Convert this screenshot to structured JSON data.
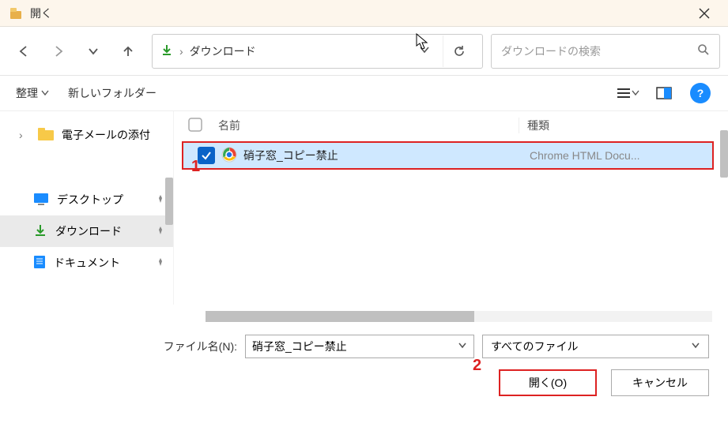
{
  "window": {
    "title": "開く"
  },
  "nav": {
    "path": "ダウンロード",
    "search_placeholder": "ダウンロードの検索"
  },
  "toolbar": {
    "organize": "整理",
    "new_folder": "新しいフォルダー"
  },
  "tree": {
    "items": [
      {
        "label": "電子メールの添付",
        "icon": "folder-yellow",
        "expandable": true
      },
      {
        "label": "デスクトップ",
        "icon": "desktop"
      },
      {
        "label": "ダウンロード",
        "icon": "download",
        "selected": true
      },
      {
        "label": "ドキュメント",
        "icon": "document"
      }
    ]
  },
  "columns": {
    "name": "名前",
    "type": "種類"
  },
  "files": {
    "row0": {
      "name": "硝子窓_コピー禁止",
      "type": "Chrome HTML Docu..."
    }
  },
  "footer": {
    "filename_label": "ファイル名(N):",
    "filename_value": "硝子窓_コピー禁止",
    "filetype": "すべてのファイル",
    "open": "開く(O)",
    "cancel": "キャンセル"
  },
  "annotations": {
    "a1": "1",
    "a2": "2"
  }
}
